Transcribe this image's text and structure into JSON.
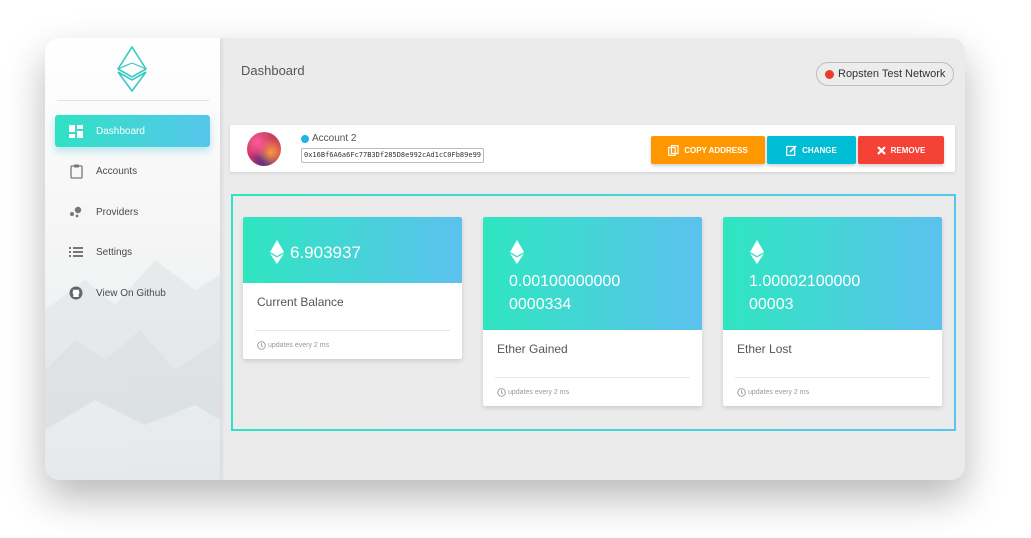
{
  "sidebar": {
    "logo_icon": "ethereum-logo-icon",
    "items": [
      {
        "label": "Dashboard",
        "icon": "dashboard-icon",
        "active": true
      },
      {
        "label": "Accounts",
        "icon": "clipboard-icon",
        "active": false
      },
      {
        "label": "Providers",
        "icon": "providers-icon",
        "active": false
      },
      {
        "label": "Settings",
        "icon": "list-icon",
        "active": false
      },
      {
        "label": "View On Github",
        "icon": "github-icon",
        "active": false
      }
    ]
  },
  "header": {
    "title": "Dashboard",
    "network_label": "Ropsten Test Network",
    "network_color": "#f03a2e"
  },
  "account": {
    "name": "Account 2",
    "status_color": "#1fb5e0",
    "address": "0x16Bf6A6a6Fc77B3Df285D8e992cAd1cC0Fb89e99",
    "buttons": {
      "copy": "COPY ADDRESS",
      "change": "CHANGE",
      "remove": "REMOVE"
    },
    "button_colors": {
      "copy": "#ff9800",
      "change": "#00bcd4",
      "remove": "#f44336"
    }
  },
  "stats": [
    {
      "value": "6.903937",
      "label": "Current Balance",
      "footer": "updates every 2 ms"
    },
    {
      "value_line1": "0.00100000000",
      "value_line2": "0000334",
      "label": "Ether Gained",
      "footer": "updates every 2 ms"
    },
    {
      "value_line1": "1.00002100000",
      "value_line2": "00003",
      "label": "Ether Lost",
      "footer": "updates every 2 ms"
    }
  ]
}
